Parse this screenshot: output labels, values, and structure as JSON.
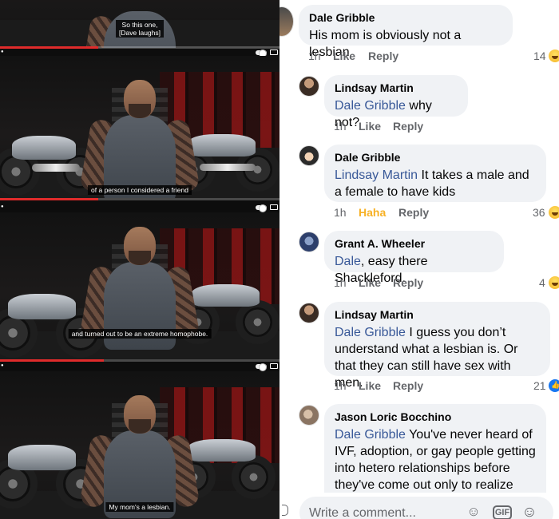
{
  "video": {
    "captions": [
      "So this one,\n[Dave laughs]",
      "of a person I considered a friend",
      "and turned out to be an extreme homophobe.",
      "My mom's a lesbian."
    ],
    "progress": [
      0.35,
      0.35,
      0.37,
      0.38
    ],
    "accent_color": "#e02b2b"
  },
  "comments": [
    {
      "author": "Dale Gribble",
      "mention": "",
      "text": "His mom is obviously not a lesbian",
      "time": "1h",
      "reaction": "Like",
      "reply": "Reply",
      "count": "14",
      "reaction_icon": "laugh-icon"
    },
    {
      "author": "Lindsay Martin",
      "mention": "Dale Gribble",
      "text": " why not?",
      "time": "1h",
      "reaction": "Like",
      "reply": "Reply",
      "count": "",
      "reaction_icon": ""
    },
    {
      "author": "Dale Gribble",
      "mention": "Lindsay Martin",
      "text": " It takes a male and a female to have kids",
      "time": "1h",
      "reaction": "Haha",
      "reply": "Reply",
      "count": "36",
      "reaction_icon": "laugh-icon"
    },
    {
      "author": "Grant A. Wheeler",
      "mention": "Dale",
      "text": ", easy there Shackleford.",
      "time": "1h",
      "reaction": "Like",
      "reply": "Reply",
      "count": "4",
      "reaction_icon": "laugh-icon"
    },
    {
      "author": "Lindsay Martin",
      "mention": "Dale Gribble",
      "text": " I guess you don’t understand what a lesbian is. Or that they can still have sex with men.",
      "time": "1h",
      "reaction": "Like",
      "reply": "Reply",
      "count": "21",
      "reaction_icon": "like-icon"
    },
    {
      "author": "Jason Loric Bocchino",
      "mention": "Dale Gribble",
      "text": " You've never heard of IVF, adoption, or gay people getting into hetero relationships before they've come out only to realize",
      "time": "",
      "reaction": "",
      "reply": "",
      "count": "",
      "reaction_icon": ""
    }
  ],
  "composer": {
    "placeholder": "Write a comment...",
    "gif_label": "GIF",
    "icons": [
      "camera-icon",
      "sticker-icon",
      "gif-icon",
      "emoji-icon"
    ]
  }
}
